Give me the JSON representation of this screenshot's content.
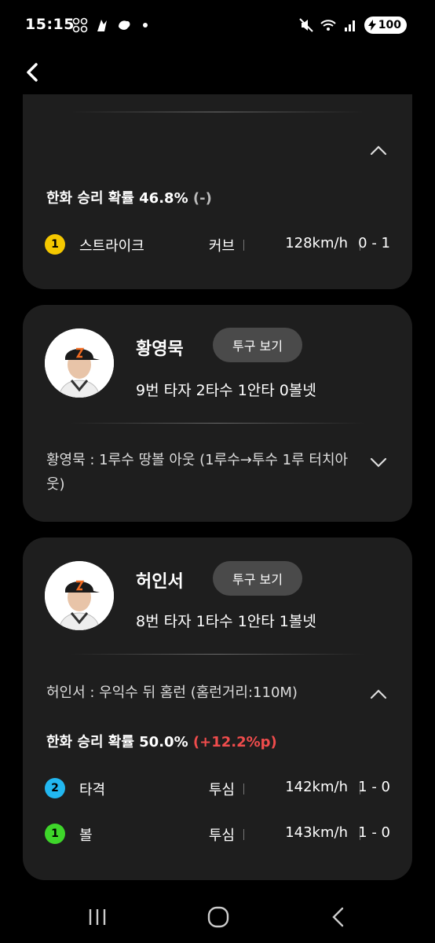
{
  "status_bar": {
    "time": "15:15",
    "battery": "100",
    "icons": [
      "app-notification-icon",
      "app-notification-icon",
      "app-notification-icon",
      "dot-icon",
      "mute-icon",
      "wifi-icon",
      "signal-icon",
      "battery-icon"
    ]
  },
  "back": {
    "icon": "chevron-left-icon"
  },
  "colors": {
    "background": "#000000",
    "card": "#1e1e1e",
    "badge_yellow": "#f5c800",
    "badge_blue": "#22b7f0",
    "badge_green": "#3ed62a",
    "delta_red": "#ef4c4c"
  },
  "card1": {
    "win_prob_label": "한화 승리 확률 46.8%",
    "win_prob_delta": "(-)",
    "pitches": [
      {
        "num": "1",
        "result": "스트라이크",
        "type": "커브",
        "speed": "128km/h",
        "count": "0 - 1",
        "color": "#f5c800"
      }
    ]
  },
  "card2": {
    "player_name": "황영묵",
    "pitch_view_label": "투구 보기",
    "batter_info": "9번 타자  2타수 1안타 0볼넷",
    "play_description": "황영묵 : 1루수 땅볼 아웃 (1루수→투수 1루 터치아웃)"
  },
  "card3": {
    "player_name": "허인서",
    "pitch_view_label": "투구 보기",
    "batter_info": "8번 타자  1타수 1안타 1볼넷",
    "play_description": "허인서 : 우익수 뒤 홈런 (홈런거리:110M)",
    "win_prob_label": "한화 승리 확률 50.0%",
    "win_prob_delta": "(+12.2%p)",
    "pitches": [
      {
        "num": "2",
        "result": "타격",
        "type": "투심",
        "speed": "142km/h",
        "count": "1 - 0",
        "color": "#22b7f0"
      },
      {
        "num": "1",
        "result": "볼",
        "type": "투심",
        "speed": "143km/h",
        "count": "1 - 0",
        "color": "#3ed62a"
      }
    ]
  },
  "nav": {
    "recent": "recent-apps-icon",
    "home": "home-icon",
    "back": "back-icon"
  }
}
